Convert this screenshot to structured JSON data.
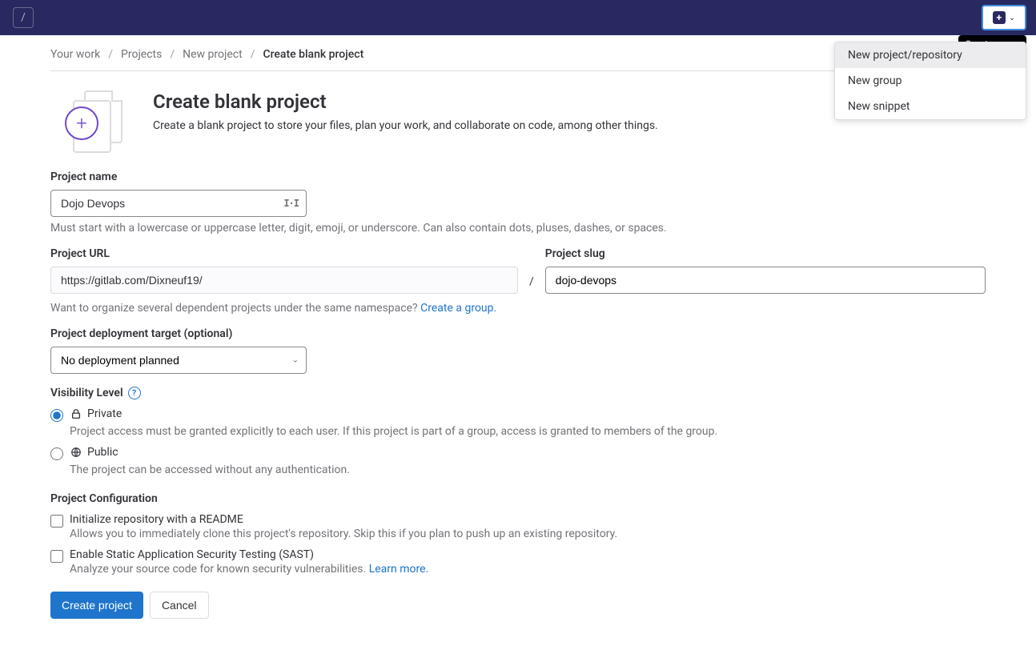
{
  "topbar": {
    "slash_key": "/",
    "tooltip": "Create new...",
    "dropdown": {
      "items": [
        "New project/repository",
        "New group",
        "New snippet"
      ]
    }
  },
  "breadcrumb": {
    "items": [
      "Your work",
      "Projects",
      "New project"
    ],
    "current": "Create blank project"
  },
  "header": {
    "title": "Create blank project",
    "subtitle": "Create a blank project to store your files, plan your work, and collaborate on code, among other things."
  },
  "form": {
    "project_name": {
      "label": "Project name",
      "value": "Dojo Devops",
      "hint": "Must start with a lowercase or uppercase letter, digit, emoji, or underscore. Can also contain dots, pluses, dashes, or spaces."
    },
    "project_url": {
      "label": "Project URL",
      "value": "https://gitlab.com/Dixneuf19/",
      "separator": "/",
      "hint_text": "Want to organize several dependent projects under the same namespace? ",
      "hint_link": "Create a group."
    },
    "project_slug": {
      "label": "Project slug",
      "value": "dojo-devops"
    },
    "deployment": {
      "label": "Project deployment target (optional)",
      "value": "No deployment planned"
    },
    "visibility": {
      "label": "Visibility Level",
      "private": {
        "label": "Private",
        "desc": "Project access must be granted explicitly to each user. If this project is part of a group, access is granted to members of the group."
      },
      "public": {
        "label": "Public",
        "desc": "The project can be accessed without any authentication."
      }
    },
    "config": {
      "label": "Project Configuration",
      "readme": {
        "label": "Initialize repository with a README",
        "desc": "Allows you to immediately clone this project's repository. Skip this if you plan to push up an existing repository."
      },
      "sast": {
        "label": "Enable Static Application Security Testing (SAST)",
        "desc_text": "Analyze your source code for known security vulnerabilities. ",
        "desc_link": "Learn more."
      }
    },
    "buttons": {
      "submit": "Create project",
      "cancel": "Cancel"
    }
  }
}
